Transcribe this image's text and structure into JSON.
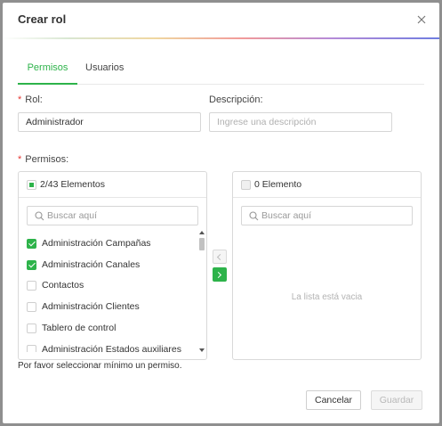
{
  "dialog": {
    "title": "Crear rol"
  },
  "tabs": [
    {
      "label": "Permisos",
      "active": true
    },
    {
      "label": "Usuarios",
      "active": false
    }
  ],
  "form": {
    "role": {
      "label": "Rol",
      "value": "Administrador"
    },
    "description": {
      "label": "Descripción",
      "placeholder": "Ingrese una descripción",
      "value": ""
    },
    "permissions_label": "Permisos"
  },
  "transfer": {
    "left": {
      "header": "2/43 Elementos",
      "search_placeholder": "Buscar aquí",
      "items": [
        {
          "label": "Administración Campañas",
          "checked": true
        },
        {
          "label": "Administración Canales",
          "checked": true
        },
        {
          "label": "Contactos",
          "checked": false
        },
        {
          "label": "Administración Clientes",
          "checked": false
        },
        {
          "label": "Tablero de control",
          "checked": false
        },
        {
          "label": "Administración Estados auxiliares",
          "checked": false
        }
      ]
    },
    "right": {
      "header": "0 Elemento",
      "search_placeholder": "Buscar aquí",
      "empty_text": "La lista está vacia"
    },
    "move_left_symbol": "<",
    "move_right_symbol": ">"
  },
  "hint": "Por favor seleccionar mínimo un permiso.",
  "buttons": {
    "cancel": "Cancelar",
    "save": "Guardar"
  },
  "colors": {
    "accent": "#2db34a",
    "required": "#e53935"
  }
}
